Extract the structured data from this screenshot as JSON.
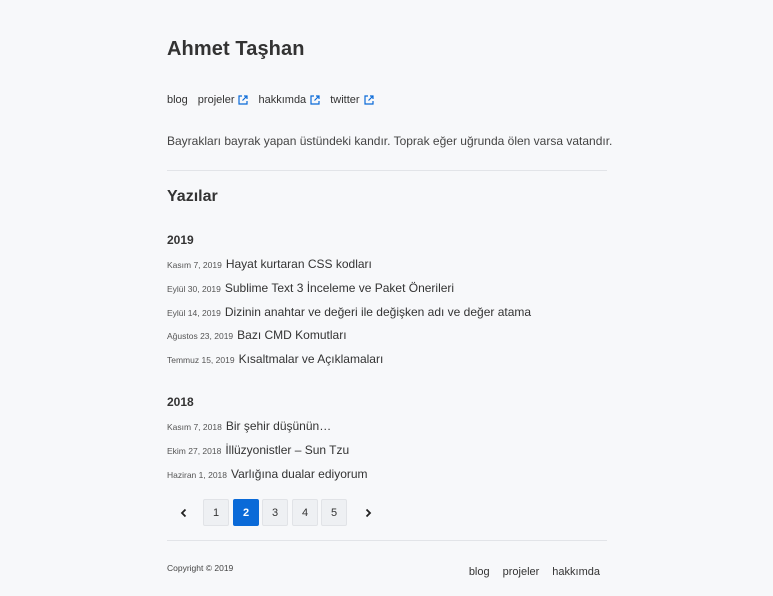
{
  "site": {
    "title": "Ahmet Taşhan"
  },
  "nav": [
    {
      "label": "blog",
      "external": false
    },
    {
      "label": "projeler",
      "external": true
    },
    {
      "label": "hakkımda",
      "external": true
    },
    {
      "label": "twitter",
      "external": true
    }
  ],
  "tagline": "Bayrakları bayrak yapan üstündeki kandır. Toprak eğer uğrunda ölen varsa vatandır.",
  "section_title": "Yazılar",
  "years": [
    {
      "year": "2019",
      "posts": [
        {
          "date": "Kasım 7, 2019",
          "title": "Hayat kurtaran CSS kodları"
        },
        {
          "date": "Eylül 30, 2019",
          "title": "Sublime Text 3 İnceleme ve Paket Önerileri"
        },
        {
          "date": "Eylül 14, 2019",
          "title": "Dizinin anahtar ve değeri ile değişken adı ve değer atama"
        },
        {
          "date": "Ağustos 23, 2019",
          "title": "Bazı CMD Komutları"
        },
        {
          "date": "Temmuz 15, 2019",
          "title": "Kısaltmalar ve Açıklamaları"
        }
      ]
    },
    {
      "year": "2018",
      "posts": [
        {
          "date": "Kasım 7, 2018",
          "title": "Bir şehir düşünün…"
        },
        {
          "date": "Ekim 27, 2018",
          "title": "İllüzyonistler – Sun Tzu"
        },
        {
          "date": "Haziran 1, 2018",
          "title": "Varlığına dualar ediyorum"
        }
      ]
    }
  ],
  "pagination": {
    "pages": [
      "1",
      "2",
      "3",
      "4",
      "5"
    ],
    "current": "2"
  },
  "footer": {
    "copyright": "Copyright © 2019",
    "nav": [
      "blog",
      "projeler",
      "hakkımda"
    ]
  },
  "colors": {
    "accent": "#0a6ad8",
    "background": "#f7f8fa"
  }
}
